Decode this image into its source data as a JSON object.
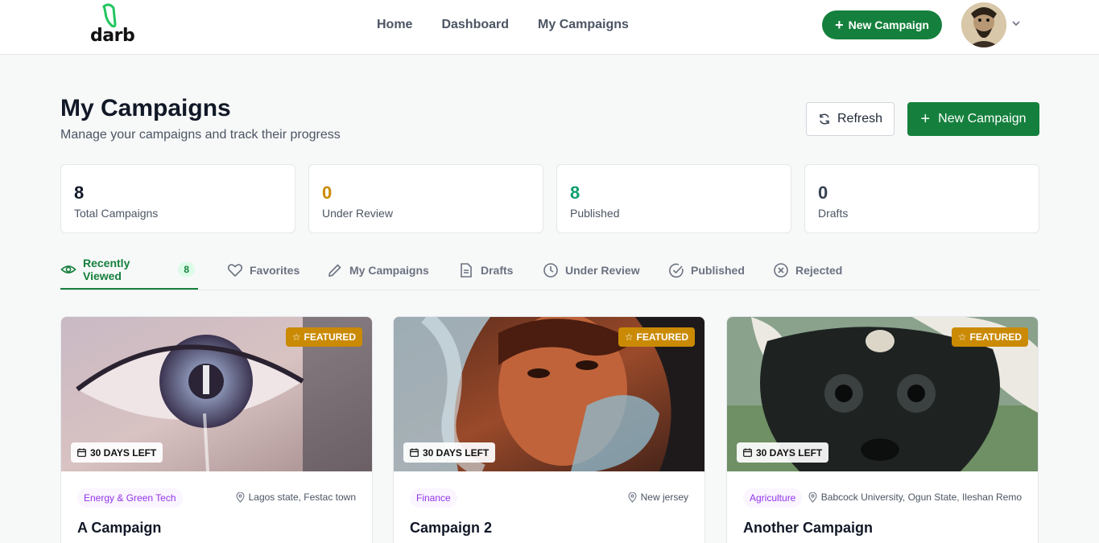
{
  "header": {
    "logo_text": "darb",
    "nav": [
      "Home",
      "Dashboard",
      "My Campaigns"
    ],
    "new_campaign_label": "New Campaign"
  },
  "page": {
    "title": "My Campaigns",
    "subtitle": "Manage your campaigns and track their progress",
    "refresh_label": "Refresh",
    "new_campaign_label": "New Campaign"
  },
  "stats": [
    {
      "value": "8",
      "label": "Total Campaigns",
      "color": "#111827"
    },
    {
      "value": "0",
      "label": "Under Review",
      "color": "#ca8a04"
    },
    {
      "value": "8",
      "label": "Published",
      "color": "#0e9f6e"
    },
    {
      "value": "0",
      "label": "Drafts",
      "color": "#374151"
    }
  ],
  "tabs": [
    {
      "label": "Recently Viewed",
      "count": "8",
      "icon": "eye-icon",
      "active": true
    },
    {
      "label": "Favorites",
      "icon": "heart-icon"
    },
    {
      "label": "My Campaigns",
      "icon": "pencil-icon"
    },
    {
      "label": "Drafts",
      "icon": "document-icon"
    },
    {
      "label": "Under Review",
      "icon": "clock-icon"
    },
    {
      "label": "Published",
      "icon": "check-circle-icon"
    },
    {
      "label": "Rejected",
      "icon": "x-circle-icon"
    }
  ],
  "cards": [
    {
      "featured": "FEATURED",
      "days_left": "30 DAYS LEFT",
      "category": "Energy & Green Tech",
      "location": "Lagos state, Festac town",
      "title": "A Campaign"
    },
    {
      "featured": "FEATURED",
      "days_left": "30 DAYS LEFT",
      "category": "Finance",
      "location": "New jersey",
      "title": "Campaign 2"
    },
    {
      "featured": "FEATURED",
      "days_left": "30 DAYS LEFT",
      "category": "Agriculture",
      "location": "Babcock University, Ogun State, Ileshan Remo",
      "title": "Another Campaign"
    }
  ],
  "colors": {
    "brand": "#15803d",
    "featured": "#ca8a04",
    "tag_text": "#9333ea"
  }
}
